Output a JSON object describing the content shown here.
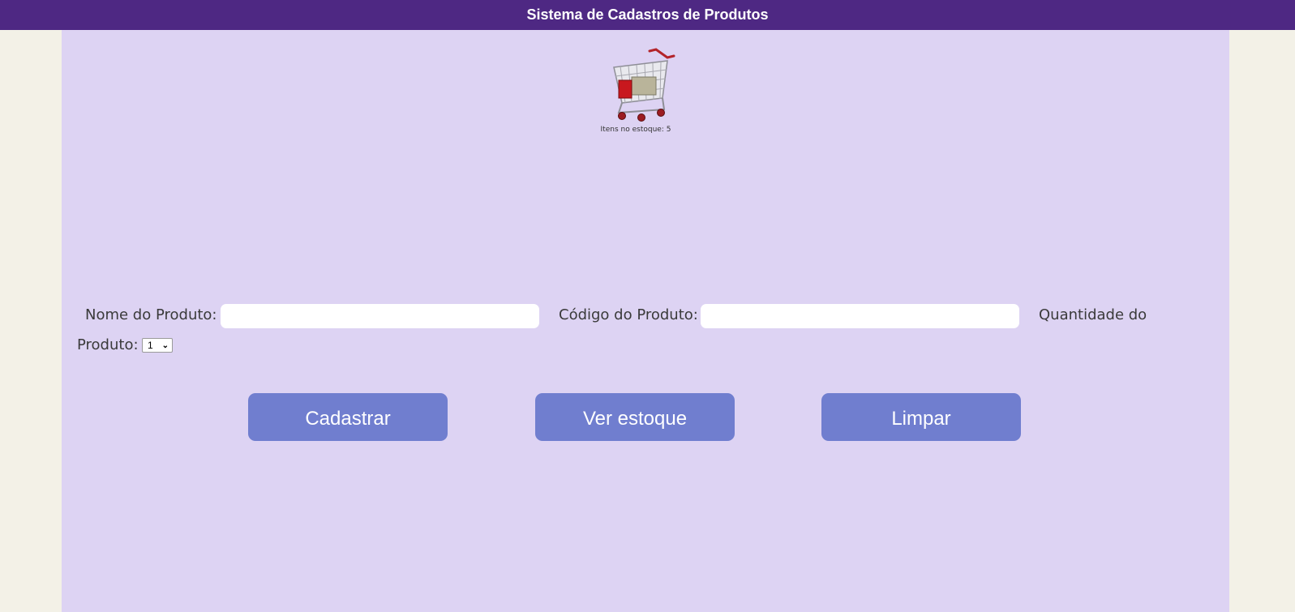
{
  "header": {
    "title": "Sistema de Cadastros de Produtos"
  },
  "stock": {
    "label": "Itens no estoque: 5",
    "icon": "shopping-cart-icon"
  },
  "form": {
    "name_label": "Nome do Produto:",
    "name_value": "",
    "code_label": "Código do Produto:",
    "code_value": "",
    "qty_label_line1": "Quantidade do",
    "qty_label_line2": "Produto:",
    "qty_selected": "1"
  },
  "buttons": {
    "register": "Cadastrar",
    "view_stock": "Ver estoque",
    "clear": "Limpar"
  },
  "colors": {
    "header_bg": "#4e2883",
    "page_bg": "#f3f1e7",
    "panel_bg": "#ddd3f3",
    "button_bg": "#707ecf"
  }
}
